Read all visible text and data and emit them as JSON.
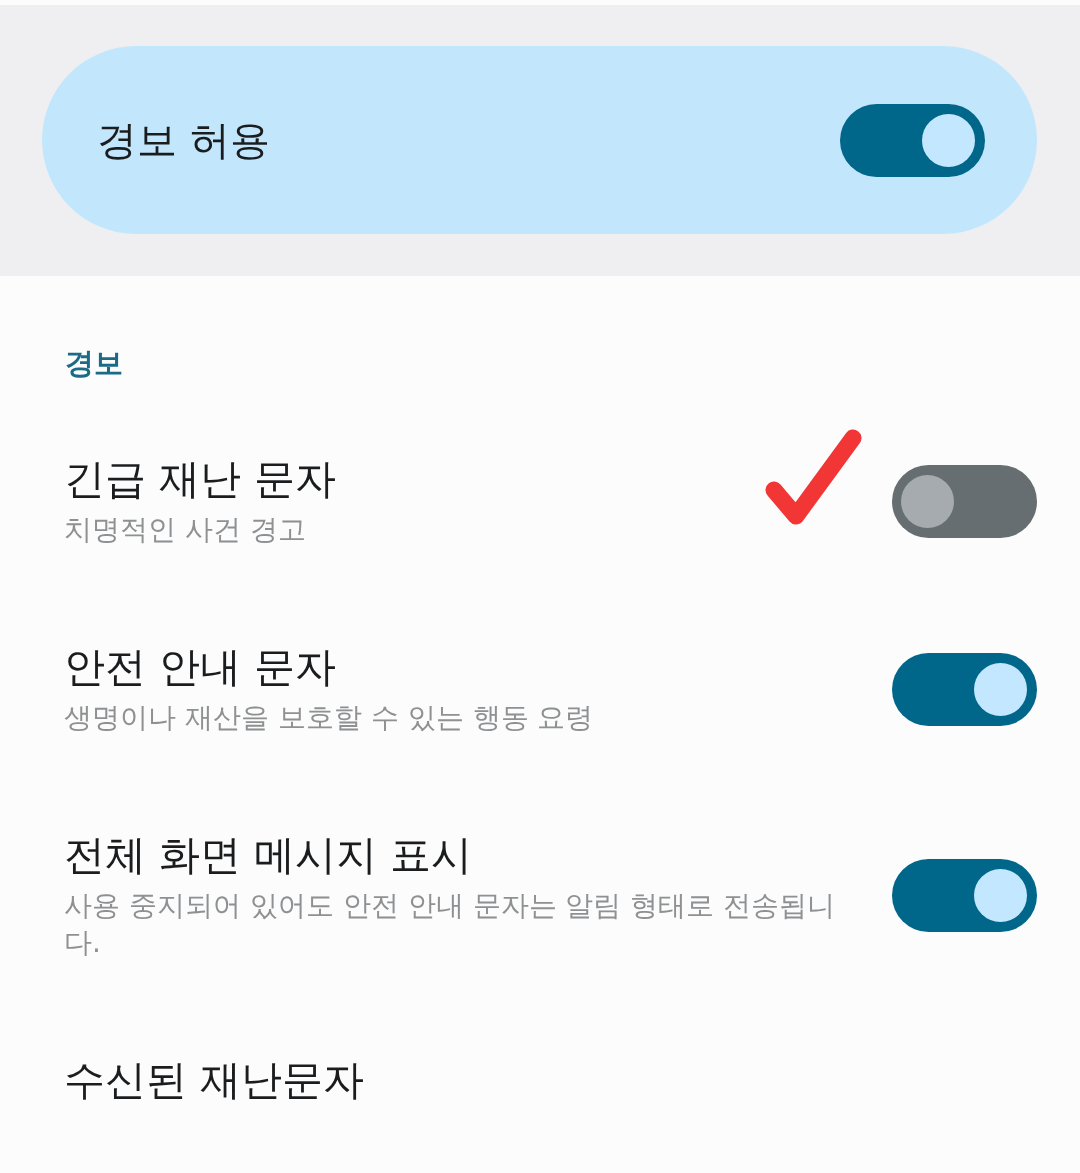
{
  "master": {
    "label": "경보 허용",
    "on": true
  },
  "section": {
    "title": "경보"
  },
  "items": [
    {
      "kind": "switch",
      "title": "긴급 재난 문자",
      "subtitle": "치명적인 사건 경고",
      "on": false,
      "marked": true
    },
    {
      "kind": "switch",
      "title": "안전 안내 문자",
      "subtitle": "생명이나 재산을 보호할 수 있는 행동 요령",
      "on": true,
      "marked": false
    },
    {
      "kind": "switch",
      "title": "전체 화면 메시지 표시",
      "subtitle": "사용 중지되어 있어도 안전 안내 문자는 알림 형태로 전송됩니다.",
      "on": true,
      "marked": false
    },
    {
      "kind": "link",
      "title": "수신된 재난문자",
      "marked": false
    }
  ]
}
